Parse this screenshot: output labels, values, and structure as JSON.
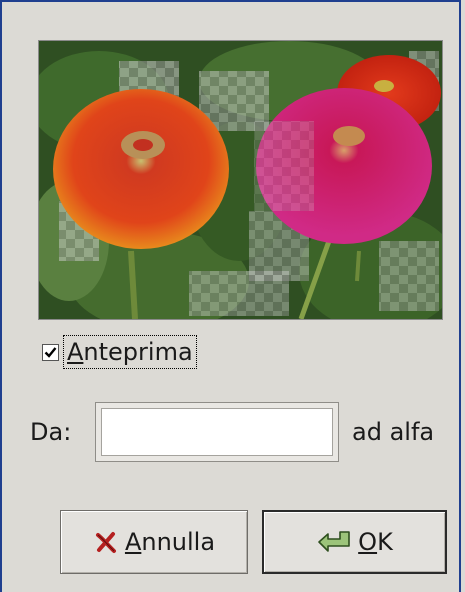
{
  "preview": {
    "alt": "flower preview"
  },
  "options": {
    "preview_checkbox_checked": true,
    "preview_label_mnemonic": "A",
    "preview_label_rest": "nteprima",
    "preview_label_prefix": ""
  },
  "from": {
    "label": "Da:",
    "value": "",
    "to_label": "ad alfa"
  },
  "buttons": {
    "cancel_mnemonic": "A",
    "cancel_rest": "nnulla",
    "ok_mnemonic": "O",
    "ok_rest": "K"
  },
  "colors": {
    "window_bg": "#dcdad5",
    "frame_border": "#1f3f8f",
    "cancel_icon": "#b52020",
    "ok_icon": "#3b6b2a"
  }
}
